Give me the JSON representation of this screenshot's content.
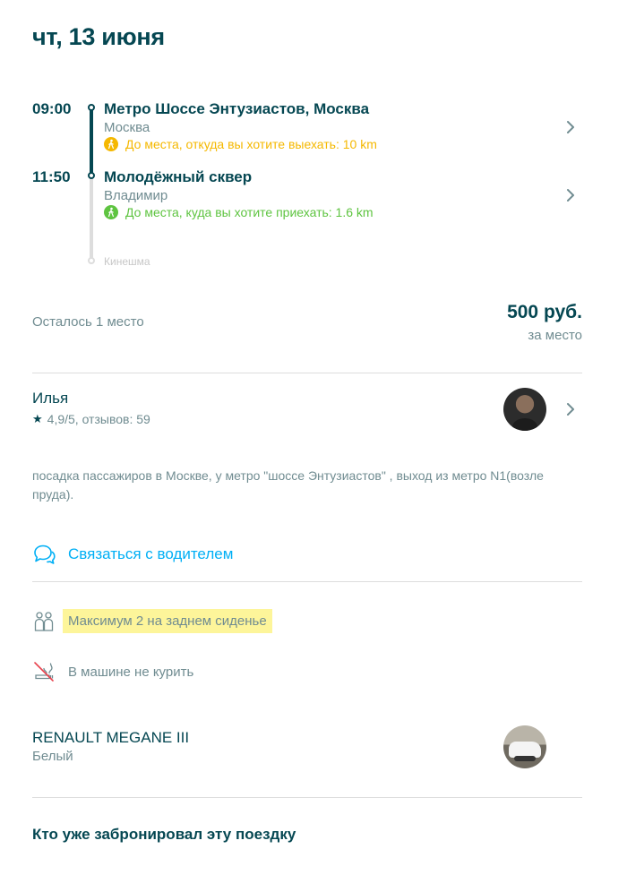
{
  "trip": {
    "date": "чт, 13 июня",
    "departure": {
      "time": "09:00",
      "title": "Метро Шоссе Энтузиастов, Москва",
      "city": "Москва",
      "walk_text": "До места, откуда вы хотите выехать: 10 km",
      "walk_color": "#f5b800"
    },
    "arrival": {
      "time": "11:50",
      "title": "Молодёжный сквер",
      "city": "Владимир",
      "walk_text": "До места, куда вы хотите приехать: 1.6 km",
      "walk_color": "#5ec440"
    },
    "final_stop": "Кинешма"
  },
  "booking": {
    "seats_left": "Осталось 1 место",
    "price": "500 руб.",
    "price_unit": "за место"
  },
  "driver": {
    "name": "Илья",
    "rating": "4,9/5, отзывов: 59",
    "note": "посадка пассажиров в Москве, у метро \"шоссе Энтузиастов\" , выход из метро N1(возле пруда).",
    "contact_label": "Связаться с водителем"
  },
  "preferences": {
    "back_seat": "Максимум 2 на заднем сиденье",
    "no_smoking": "В машине не курить"
  },
  "car": {
    "model": "RENAULT MEGANE III",
    "color": "Белый"
  },
  "passengers": {
    "title": "Кто уже забронировал эту поездку"
  },
  "theme": {
    "primary": "#054752",
    "secondary_text": "#708c91",
    "accent": "#00aff5",
    "highlight": "#fdf59a"
  }
}
